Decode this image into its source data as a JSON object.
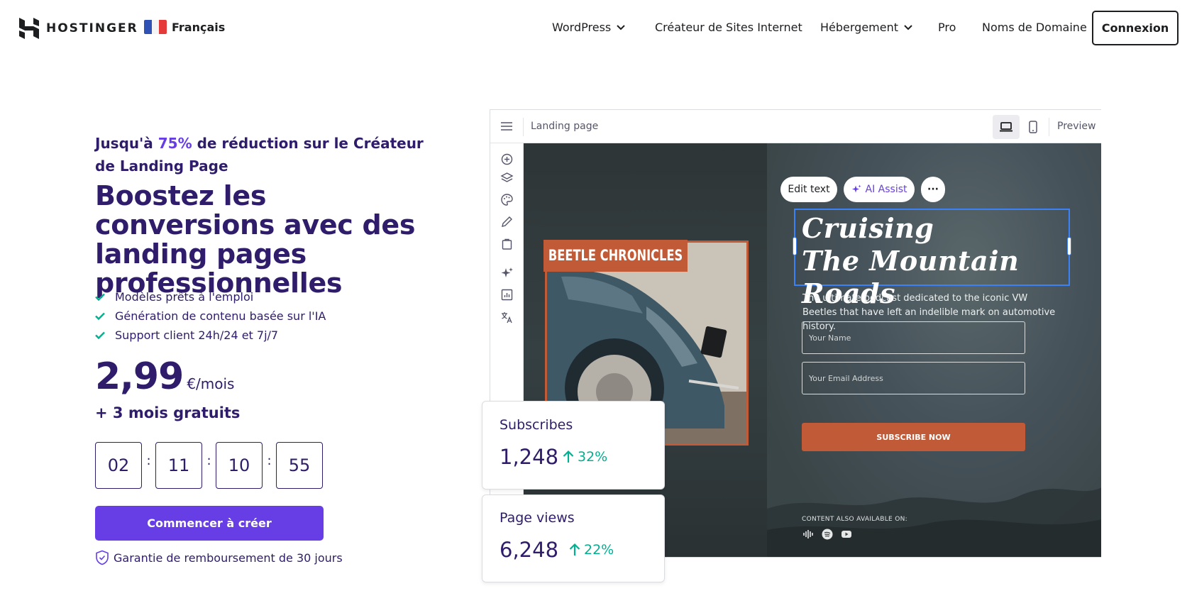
{
  "header": {
    "brand": "HOSTINGER",
    "language": "Français",
    "nav": [
      {
        "label": "WordPress",
        "dropdown": true
      },
      {
        "label": "Créateur de Sites Internet",
        "dropdown": false
      },
      {
        "label": "Hébergement",
        "dropdown": true
      },
      {
        "label": "Pro",
        "dropdown": false
      },
      {
        "label": "Noms de Domaine",
        "dropdown": false
      }
    ],
    "login": "Connexion"
  },
  "hero": {
    "promo_prefix": "Jusqu'à ",
    "promo_accent": "75%",
    "promo_suffix": " de réduction sur le Créateur de Landing Page",
    "headline": "Boostez les conversions avec des landing pages professionnelles",
    "features": [
      "Modèles prêts à l'emploi",
      "Génération de contenu basée sur l'IA",
      "Support client 24h/24 et 7j/7"
    ],
    "price": "2,99",
    "price_unit": "€/mois",
    "bonus": "+ 3 mois gratuits",
    "countdown": [
      "02",
      "11",
      "10",
      "55"
    ],
    "countdown_separator": ":",
    "cta": "Commencer à créer",
    "guarantee": "Garantie de remboursement de 30 jours"
  },
  "editor": {
    "page_title": "Landing page",
    "preview": "Preview",
    "toolbar": {
      "edit_text": "Edit text",
      "ai_assist": "AI Assist",
      "more": "···"
    },
    "landing": {
      "tag": "BEETLE CHRONICLES",
      "title_line1": "Cruising",
      "title_line2": "The Mountain Roads",
      "description": "The ultimate podcast dedicated to the iconic VW Beetles that have left an indelible mark on automotive history.",
      "name_placeholder": "Your Name",
      "email_placeholder": "Your Email Address",
      "subscribe": "SUBSCRIBE NOW",
      "available_on": "CONTENT ALSO AVAILABLE ON:",
      "platforms": [
        "podcasts-icon",
        "spotify-icon",
        "youtube-icon"
      ]
    }
  },
  "stats": [
    {
      "label": "Subscribes",
      "value": "1,248",
      "change": "32%"
    },
    {
      "label": "Page views",
      "value": "6,248",
      "change": "22%"
    }
  ],
  "colors": {
    "brand_purple": "#673de6",
    "text_dark": "#2f1c6a",
    "check_green": "#00b090",
    "landing_orange": "#c15a36",
    "selection_blue": "#3b82f6"
  }
}
